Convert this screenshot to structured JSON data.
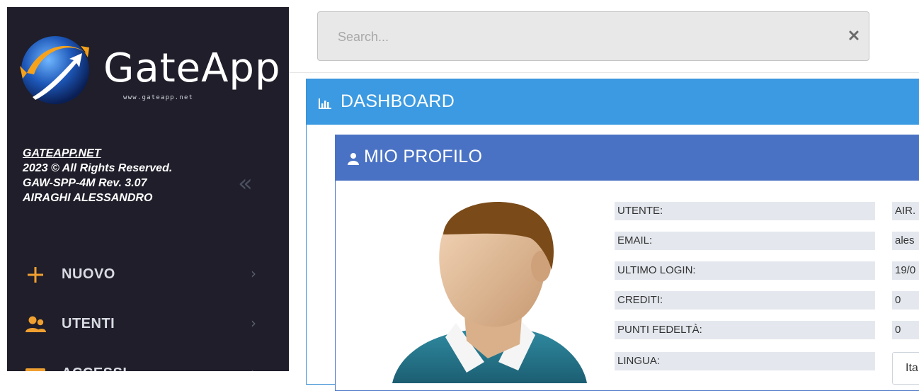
{
  "search": {
    "placeholder": "Search..."
  },
  "sidebar": {
    "brand": "GateApp",
    "brand_url": "www.gateapp.net",
    "info": {
      "link": "GATEAPP.NET",
      "copyright": "2023 © All Rights Reserved.",
      "revision": "GAW-SPP-4M Rev. 3.07",
      "user": "AIRAGHI ALESSANDRO"
    },
    "collapse_glyph": "«",
    "menu": [
      {
        "label": "NUOVO",
        "icon": "plus-icon",
        "color": "#f0a030"
      },
      {
        "label": "UTENTI",
        "icon": "users-icon",
        "color": "#f0a030"
      },
      {
        "label": "ACCESSI",
        "icon": "card-icon",
        "color": "#f0a030"
      }
    ]
  },
  "dashboard": {
    "title": "DASHBOARD",
    "profile": {
      "title": "MIO PROFILO",
      "rows": [
        {
          "label": "UTENTE:",
          "value": "AIR."
        },
        {
          "label": "EMAIL:",
          "value": "ales"
        },
        {
          "label": "ULTIMO LOGIN:",
          "value": "19/0"
        },
        {
          "label": "CREDITI:",
          "value": "0"
        },
        {
          "label": "PUNTI FEDELTÀ:",
          "value": "0"
        },
        {
          "label": "LINGUA:",
          "value": "Ita"
        }
      ]
    }
  },
  "colors": {
    "sidebar_bg": "#1f1e2a",
    "dashboard_header": "#3b9ae1",
    "profile_header": "#4a72c4",
    "accent_orange": "#f0a030"
  }
}
